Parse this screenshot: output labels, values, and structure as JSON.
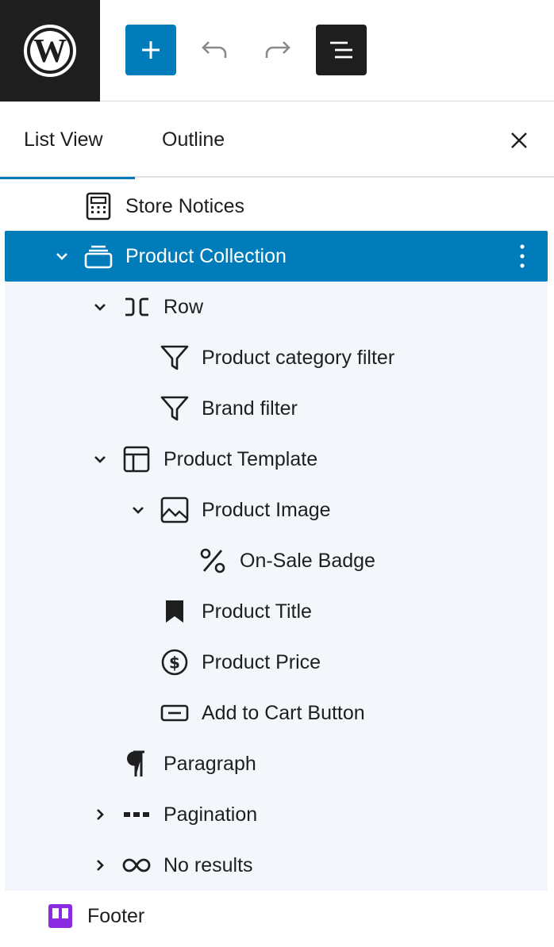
{
  "toolbar": {
    "logo_icon": "wordpress-logo",
    "add_icon": "plus-icon",
    "undo_icon": "undo-icon",
    "redo_icon": "redo-icon",
    "list_view_icon": "list-view-icon"
  },
  "tabs": {
    "list_view": "List View",
    "outline": "Outline",
    "close_icon": "close-icon"
  },
  "tree": {
    "items": [
      {
        "label": "Store Notices",
        "icon": "store-notices-icon"
      },
      {
        "label": "Product Collection",
        "icon": "product-collection-icon",
        "selected": true,
        "expanded": true
      },
      {
        "label": "Row",
        "icon": "row-icon",
        "expanded": true
      },
      {
        "label": "Product category filter",
        "icon": "filter-icon"
      },
      {
        "label": "Brand filter",
        "icon": "filter-icon"
      },
      {
        "label": "Product Template",
        "icon": "layout-icon",
        "expanded": true
      },
      {
        "label": "Product Image",
        "icon": "image-icon",
        "expanded": true
      },
      {
        "label": "On-Sale Badge",
        "icon": "percent-icon"
      },
      {
        "label": "Product Title",
        "icon": "bookmark-icon"
      },
      {
        "label": "Product Price",
        "icon": "dollar-circle-icon"
      },
      {
        "label": "Add to Cart Button",
        "icon": "button-icon"
      },
      {
        "label": "Paragraph",
        "icon": "paragraph-icon"
      },
      {
        "label": "Pagination",
        "icon": "pagination-icon",
        "expanded": false
      },
      {
        "label": "No results",
        "icon": "no-results-icon",
        "expanded": false
      },
      {
        "label": "Footer",
        "icon": "footer-icon"
      }
    ]
  },
  "colors": {
    "accent": "#007cba",
    "dark": "#1e1e1e",
    "nested_background": "#f3f7fb",
    "footer_icon": "#8a2be2"
  }
}
